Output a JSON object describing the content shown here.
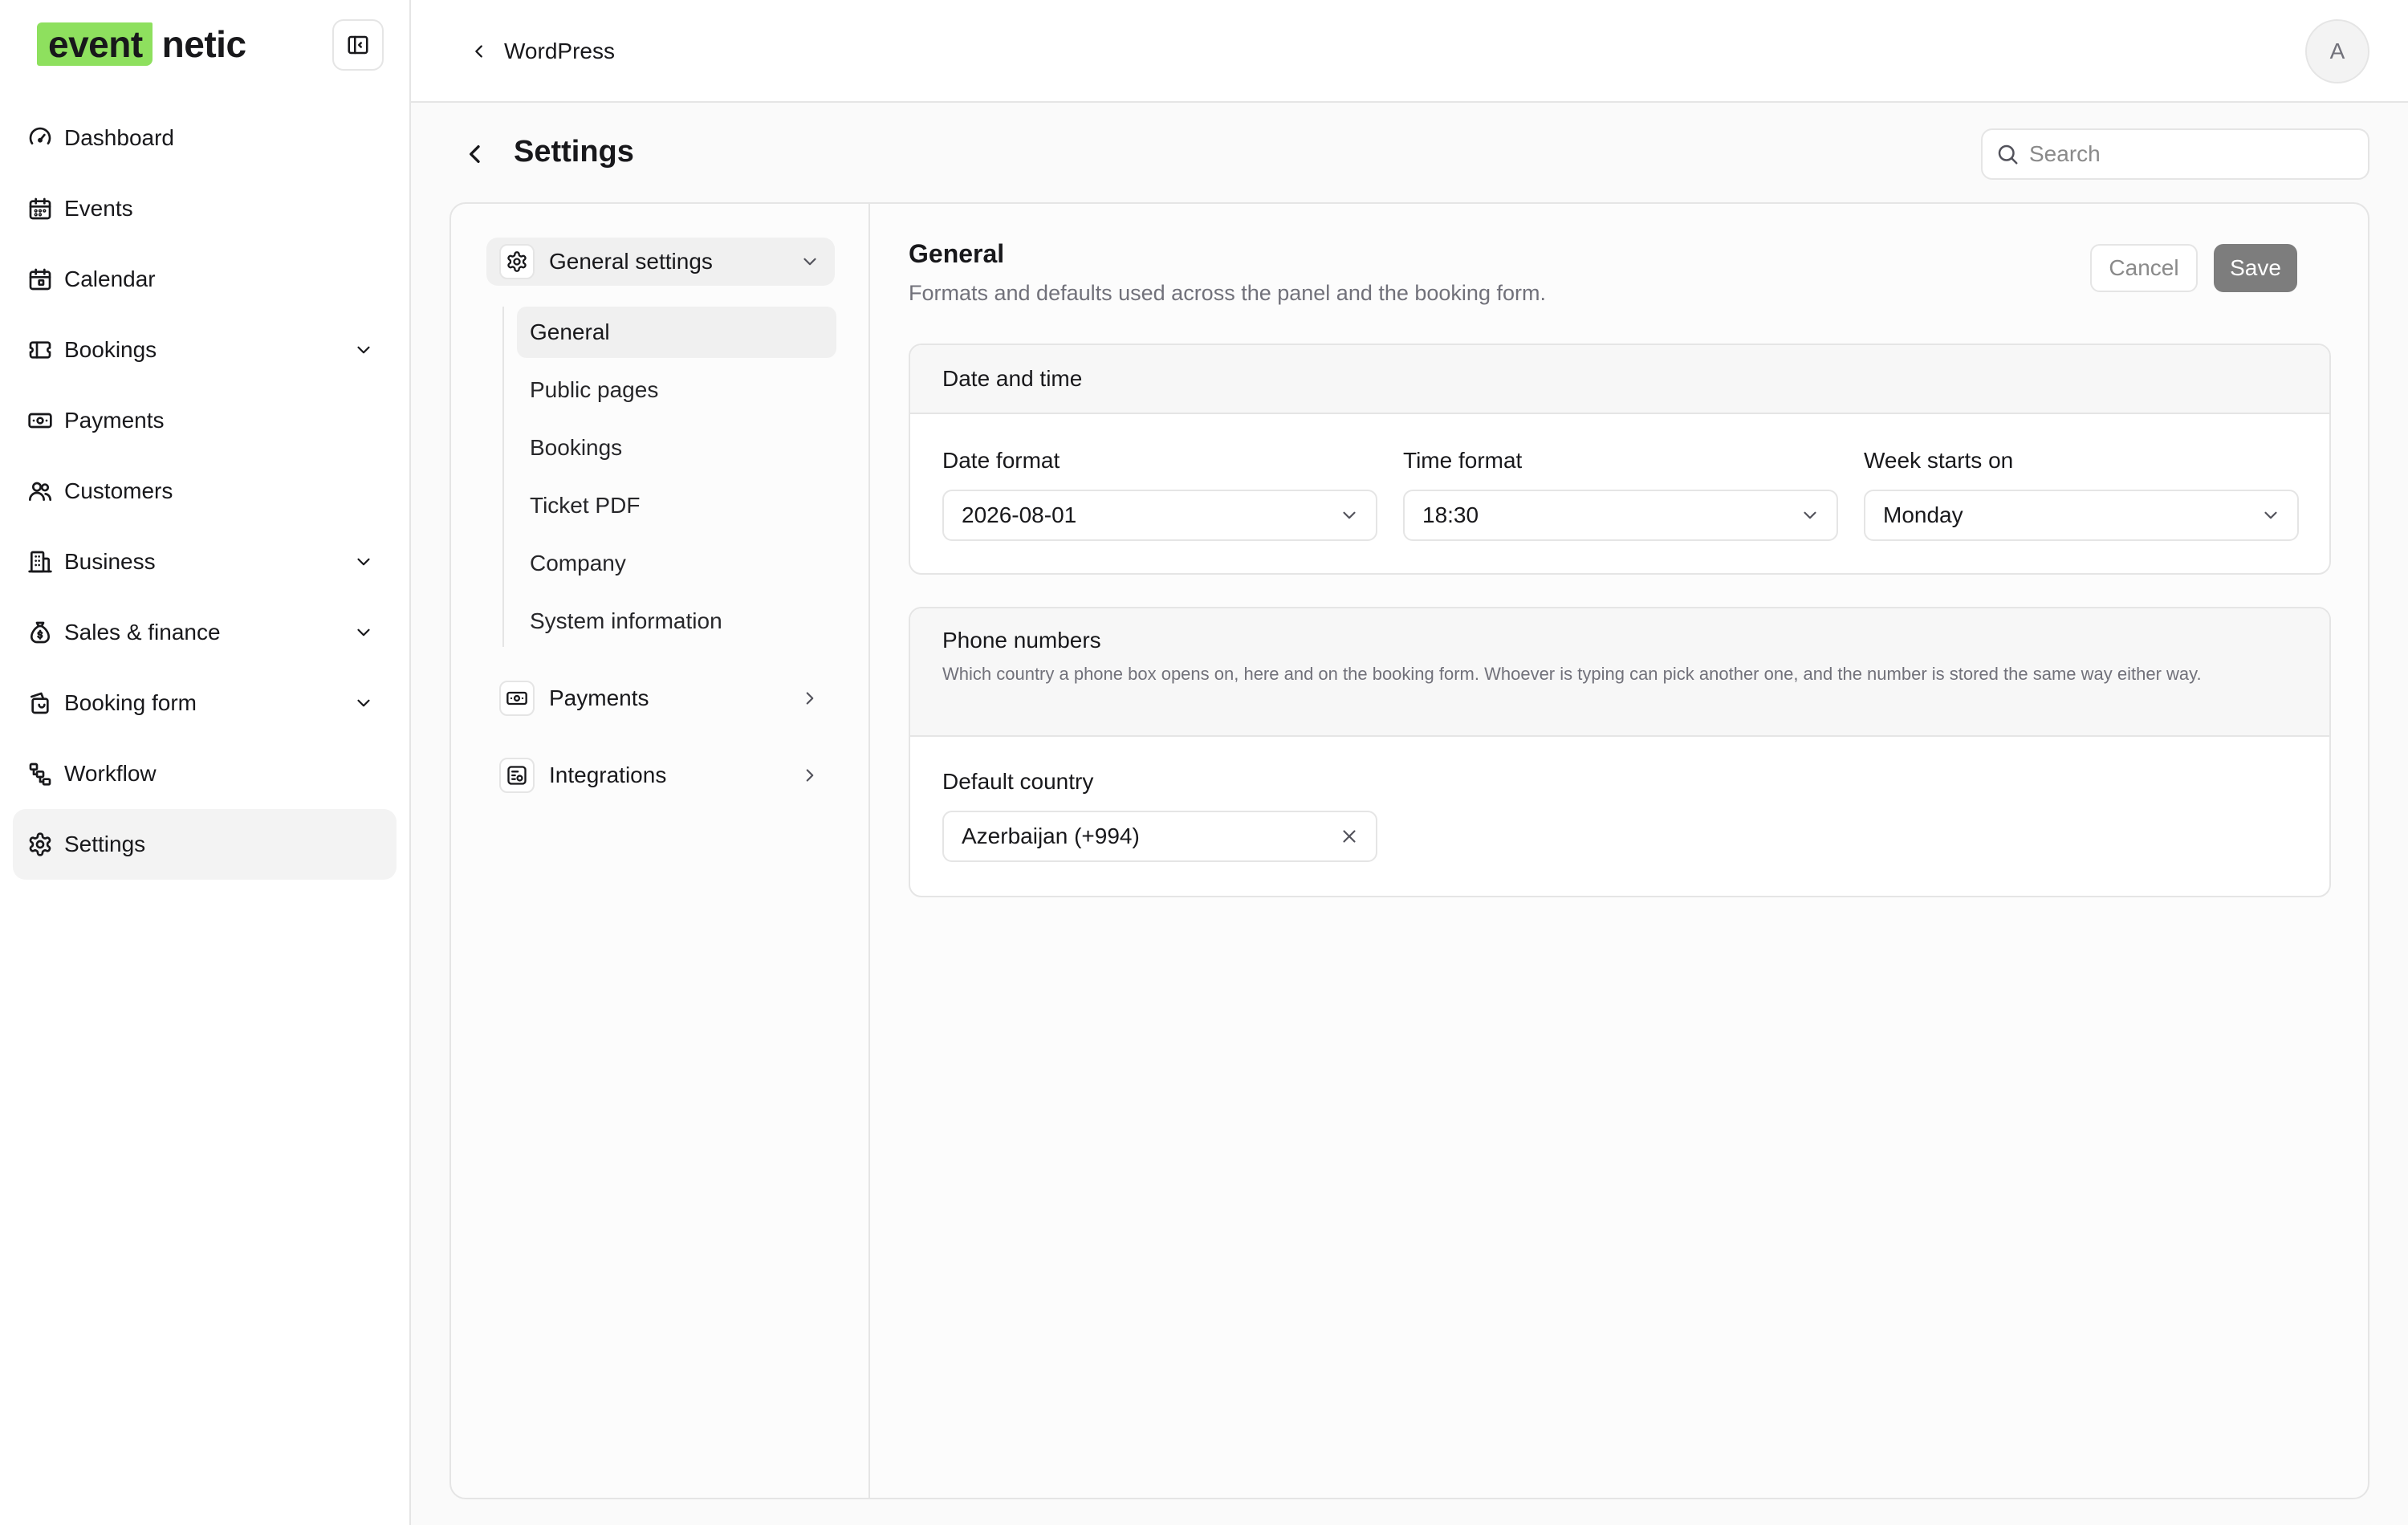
{
  "app": {
    "logo_mark": "event",
    "logo_rest": "netic"
  },
  "sidebar": {
    "items": [
      {
        "label": "Dashboard",
        "icon": "gauge-icon",
        "expandable": false
      },
      {
        "label": "Events",
        "icon": "calendar-icon",
        "expandable": false
      },
      {
        "label": "Calendar",
        "icon": "calendar-days-icon",
        "expandable": false
      },
      {
        "label": "Bookings",
        "icon": "ticket-icon",
        "expandable": true
      },
      {
        "label": "Payments",
        "icon": "banknote-icon",
        "expandable": false
      },
      {
        "label": "Customers",
        "icon": "users-icon",
        "expandable": false
      },
      {
        "label": "Business",
        "icon": "building-icon",
        "expandable": true
      },
      {
        "label": "Sales & finance",
        "icon": "money-bag-icon",
        "expandable": true
      },
      {
        "label": "Booking form",
        "icon": "form-icon",
        "expandable": true
      },
      {
        "label": "Workflow",
        "icon": "workflow-icon",
        "expandable": false
      },
      {
        "label": "Settings",
        "icon": "gear-icon",
        "expandable": false,
        "active": true
      }
    ]
  },
  "topbar": {
    "breadcrumb": "WordPress",
    "avatar_initial": "A"
  },
  "page": {
    "title": "Settings",
    "search_placeholder": "Search"
  },
  "settings_nav": {
    "general_group": "General settings",
    "general_items": [
      "General",
      "Public pages",
      "Bookings",
      "Ticket PDF",
      "Company",
      "System information"
    ],
    "payments_group": "Payments",
    "integrations_group": "Integrations"
  },
  "general": {
    "title": "General",
    "description": "Formats and defaults used across the panel and the booking form.",
    "cancel_label": "Cancel",
    "save_label": "Save",
    "date_time": {
      "title": "Date and time",
      "date_format_label": "Date format",
      "date_format_value": "2026-08-01",
      "time_format_label": "Time format",
      "time_format_value": "18:30",
      "week_start_label": "Week starts on",
      "week_start_value": "Monday"
    },
    "phone": {
      "title": "Phone numbers",
      "description": "Which country a phone box opens on, here and on the booking form. Whoever is typing can pick another one, and the number is stored the same way either way.",
      "default_country_label": "Default country",
      "default_country_value": "Azerbaijan (+994)"
    }
  },
  "colors": {
    "brand": "#8ee05e",
    "save_button": "#7d7d7d",
    "border": "#e5e5e5"
  }
}
